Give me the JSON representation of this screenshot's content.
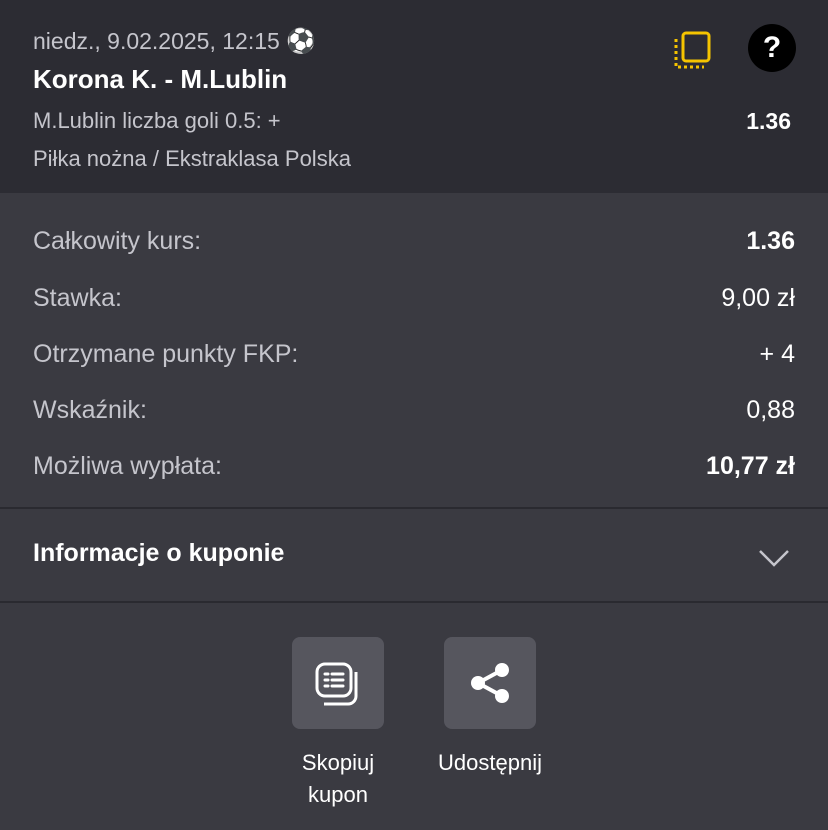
{
  "event": {
    "date": "niedz., 9.02.2025, 12:15",
    "sport_emoji": "⚽",
    "match": "Korona K. - M.Lublin",
    "selection": "M.Lublin liczba goli 0.5: +",
    "odds": "1.36",
    "league": "Piłka nożna / Ekstraklasa Polska",
    "icons": {
      "copy": "copy-coupon-icon",
      "help": "help-icon"
    },
    "help_glyph": "?"
  },
  "summary": {
    "total_odds_label": "Całkowity kurs:",
    "total_odds_value": "1.36",
    "stake_label": "Stawka:",
    "stake_value": "9,00 zł",
    "points_label": "Otrzymane punkty FKP:",
    "points_value": "+ 4",
    "indicator_label": "Wskaźnik:",
    "indicator_value": "0,88",
    "payout_label": "Możliwa wypłata:",
    "payout_value": "10,77 zł"
  },
  "info": {
    "label": "Informacje o kuponie",
    "icon": "chevron-down-icon"
  },
  "actions": {
    "copy_label_line1": "Skopiuj",
    "copy_label_line2": "kupon",
    "share_label": "Udostępnij"
  },
  "colors": {
    "background": "#3a3a41",
    "header_background": "#2c2c33",
    "accent": "#f5c400",
    "button_background": "#56565e"
  }
}
